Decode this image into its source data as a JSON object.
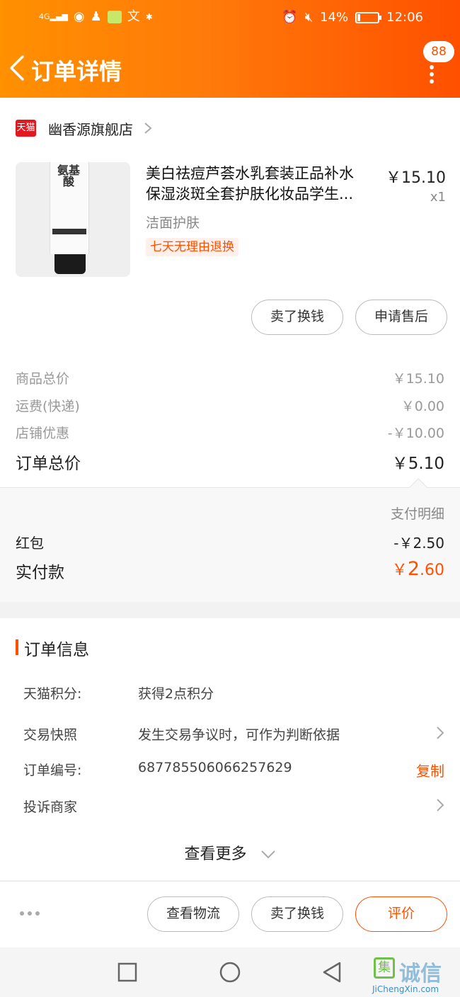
{
  "status_bar": {
    "network": "4G",
    "battery_pct": "14%",
    "battery_level": 0.14,
    "time": "12:06",
    "app_icon_text": "文"
  },
  "header": {
    "title": "订单详情",
    "message_count": "88"
  },
  "shop": {
    "badge": "天猫",
    "name": "幽香源旗舰店"
  },
  "product": {
    "image_text": "氨基酸",
    "title_line1": "美白祛痘芦荟水乳套装正品补水",
    "title_line2": "保湿淡斑全套护肤化妆品学生...",
    "price": "￥15.10",
    "quantity": "x1",
    "spec": "洁面护肤",
    "return_tag": "七天无理由退换",
    "actions": [
      "卖了换钱",
      "申请售后"
    ]
  },
  "pricing": {
    "rows": [
      {
        "label": "商品总价",
        "value": "￥15.10"
      },
      {
        "label": "运费(快递)",
        "value": "￥0.00"
      },
      {
        "label": "店铺优惠",
        "value": "-￥10.00"
      }
    ],
    "total_label": "订单总价",
    "total_value": "￥5.10"
  },
  "payment": {
    "detail_link": "支付明细",
    "redpack_label": "红包",
    "redpack_value": "-￥2.50",
    "paid_label": "实付款",
    "paid_currency": "￥",
    "paid_int": "2",
    "paid_dec": ".60"
  },
  "order_info": {
    "section_title": "订单信息",
    "points_label": "天猫积分:",
    "points_value": "获得2点积分",
    "snapshot_label": "交易快照",
    "snapshot_value": "发生交易争议时，可作为判断依据",
    "order_no_label": "订单编号:",
    "order_no_value": "687785506066257629",
    "copy_label": "复制",
    "complain_label": "投诉商家",
    "see_more": "查看更多"
  },
  "bottom_actions": {
    "logistics": "查看物流",
    "sell": "卖了换钱",
    "review": "评价"
  },
  "watermark": {
    "text": "诚信",
    "mark": "集",
    "url": "JiChengXin.com"
  },
  "colors": {
    "brand_orange": "#ff5000",
    "header_gradient_start": "#ff9000",
    "tmall_red": "#e4171f"
  }
}
